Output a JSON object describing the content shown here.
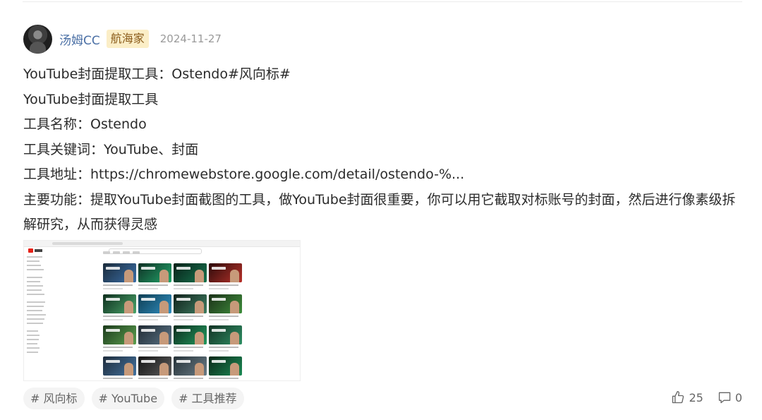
{
  "post": {
    "author": "汤姆CC",
    "badge": "航海家",
    "date": "2024-11-27",
    "lines": [
      "YouTube封面提取工具：Ostendo#风向标#",
      "YouTube封面提取工具",
      "工具名称：Ostendo",
      "工具关键词：YouTube、封面",
      "工具地址：https://chromewebstore.google.com/detail/ostendo-%...",
      "主要功能：提取YouTube封面截图的工具，做YouTube封面很重要，你可以用它截取对标账号的封面，然后进行像素级拆解研究，从而获得灵感"
    ],
    "tags": [
      "# 风向标",
      "# YouTube",
      "# 工具推荐"
    ],
    "likes": "25",
    "comments": "0"
  },
  "icons": {
    "like": "thumbs-up-icon",
    "comment": "comment-icon"
  },
  "colors": {
    "author_link": "#4a6fa5",
    "badge_bg": "#fbeec7",
    "badge_text": "#8a5b1a",
    "tag_bg": "#f4f4f4"
  }
}
